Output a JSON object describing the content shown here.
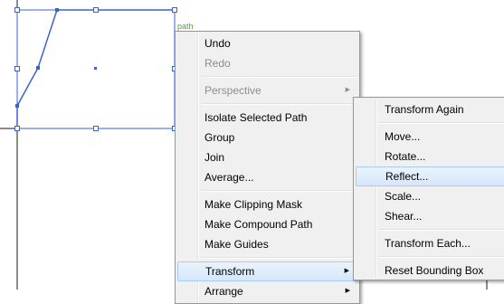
{
  "canvas": {
    "path_label": "path"
  },
  "context_menu": {
    "items": [
      {
        "type": "item",
        "label": "Undo"
      },
      {
        "type": "item",
        "label": "Redo",
        "disabled": true
      },
      {
        "type": "sep"
      },
      {
        "type": "item",
        "label": "Perspective",
        "disabled": true,
        "submenu": true
      },
      {
        "type": "sep"
      },
      {
        "type": "item",
        "label": "Isolate Selected Path"
      },
      {
        "type": "item",
        "label": "Group"
      },
      {
        "type": "item",
        "label": "Join"
      },
      {
        "type": "item",
        "label": "Average..."
      },
      {
        "type": "sep"
      },
      {
        "type": "item",
        "label": "Make Clipping Mask"
      },
      {
        "type": "item",
        "label": "Make Compound Path"
      },
      {
        "type": "item",
        "label": "Make Guides"
      },
      {
        "type": "sep"
      },
      {
        "type": "item",
        "label": "Transform",
        "submenu": true,
        "highlight": true
      },
      {
        "type": "item",
        "label": "Arrange",
        "submenu": true
      }
    ]
  },
  "transform_submenu": {
    "items": [
      {
        "type": "item",
        "label": "Transform Again"
      },
      {
        "type": "sep"
      },
      {
        "type": "item",
        "label": "Move..."
      },
      {
        "type": "item",
        "label": "Rotate..."
      },
      {
        "type": "item",
        "label": "Reflect...",
        "highlight": true
      },
      {
        "type": "item",
        "label": "Scale..."
      },
      {
        "type": "item",
        "label": "Shear..."
      },
      {
        "type": "sep"
      },
      {
        "type": "item",
        "label": "Transform Each..."
      },
      {
        "type": "sep"
      },
      {
        "type": "item",
        "label": "Reset Bounding Box"
      }
    ]
  },
  "colors": {
    "selection": "#3a63c9",
    "smart_guide": "#4dab2e",
    "highlight_border": "#a8cbef"
  }
}
